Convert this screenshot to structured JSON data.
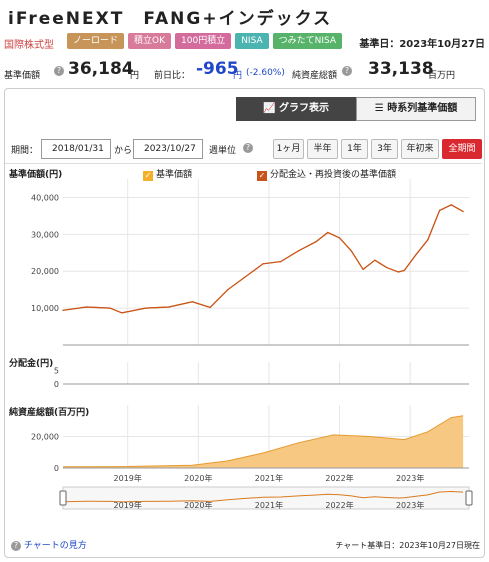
{
  "fund": {
    "title": "iFreeNEXT　FANG+インデックス",
    "category": "国際株式型"
  },
  "tags": [
    {
      "label": "ノーロード",
      "color": "#c79559"
    },
    {
      "label": "積立OK",
      "color": "#d87a9a"
    },
    {
      "label": "100円積立",
      "color": "#d36b9c"
    },
    {
      "label": "NISA",
      "color": "#4bb3b0"
    },
    {
      "label": "つみたてNISA",
      "color": "#58b36a"
    }
  ],
  "base_date": "基準日：2023年10月27日",
  "stats": {
    "nav_label": "基準価額",
    "nav_value": "36,184",
    "nav_unit": "円",
    "change_label": "前日比：",
    "change_value": "-965",
    "change_unit": "円",
    "change_pct": "(-2.60%)",
    "assets_label": "純資産総額",
    "assets_value": "33,138",
    "assets_unit": "百万円"
  },
  "view_tabs": {
    "graph": "グラフ表示",
    "table": "時系列基準価額"
  },
  "period": {
    "label": "期間：",
    "from": "2018/01/31",
    "to_word": "から",
    "to": "2023/10/27",
    "unit_label": "週単位",
    "ranges": [
      "1ヶ月",
      "半年",
      "1年",
      "3年",
      "年初来",
      "全期間"
    ],
    "active_range": "全期間"
  },
  "legend": {
    "nav_axis": "基準価額(円)",
    "nav": "基準価額",
    "reinvest": "分配金込・再投資後の基準価額",
    "dist_axis": "分配金(円)",
    "assets_axis": "純資産総額(百万円)"
  },
  "colors": {
    "nav": "#d97a1e",
    "reinvest": "#c9541a",
    "assets_fill": "#f7c882",
    "assets_line": "#e59a2e",
    "accent": "#d9282f"
  },
  "chart_data": [
    {
      "type": "line",
      "title": "",
      "ylabel": "基準価額(円)",
      "ylim": [
        0,
        45000
      ],
      "yticks": [
        "10,000",
        "20,000",
        "30,000",
        "40,000"
      ],
      "xticks": [
        "2019年",
        "2020年",
        "2021年",
        "2022年",
        "2023年"
      ],
      "x": [
        "2018-02",
        "2018-06",
        "2018-10",
        "2018-12",
        "2019-04",
        "2019-08",
        "2019-12",
        "2020-03",
        "2020-06",
        "2020-09",
        "2020-12",
        "2021-03",
        "2021-06",
        "2021-09",
        "2021-11",
        "2022-01",
        "2022-03",
        "2022-05",
        "2022-07",
        "2022-09",
        "2022-11",
        "2022-12",
        "2023-02",
        "2023-04",
        "2023-06",
        "2023-08",
        "2023-10"
      ],
      "series": [
        {
          "name": "基準価額",
          "values": [
            9400,
            10300,
            10000,
            8700,
            10000,
            10300,
            11700,
            10200,
            15000,
            18500,
            22000,
            22600,
            25500,
            28000,
            30500,
            29000,
            25500,
            20500,
            23000,
            21000,
            19800,
            20200,
            24500,
            28500,
            36500,
            38000,
            36184
          ]
        },
        {
          "name": "分配金込・再投資後の基準価額",
          "values": [
            9400,
            10300,
            10000,
            8700,
            10000,
            10300,
            11700,
            10200,
            15000,
            18500,
            22000,
            22600,
            25500,
            28000,
            30500,
            29000,
            25500,
            20500,
            23000,
            21000,
            19800,
            20200,
            24500,
            28500,
            36500,
            38000,
            36184
          ]
        }
      ]
    },
    {
      "type": "bar",
      "title": "",
      "ylabel": "分配金(円)",
      "ylim": [
        0,
        8
      ],
      "yticks": [
        "0",
        "5"
      ],
      "values": []
    },
    {
      "type": "area",
      "title": "",
      "ylabel": "純資産総額(百万円)",
      "ylim": [
        0,
        40000
      ],
      "yticks": [
        "0",
        "20,000"
      ],
      "x": [
        "2018-02",
        "2018-12",
        "2019-12",
        "2020-06",
        "2020-12",
        "2021-06",
        "2021-12",
        "2022-06",
        "2022-12",
        "2023-04",
        "2023-08",
        "2023-10"
      ],
      "values": [
        800,
        900,
        1800,
        4500,
        9500,
        16000,
        21000,
        20000,
        18000,
        23000,
        32000,
        33138
      ]
    }
  ],
  "footer": {
    "guide": "チャートの見方",
    "note": "チャート基準日：2023年10月27日現在"
  }
}
